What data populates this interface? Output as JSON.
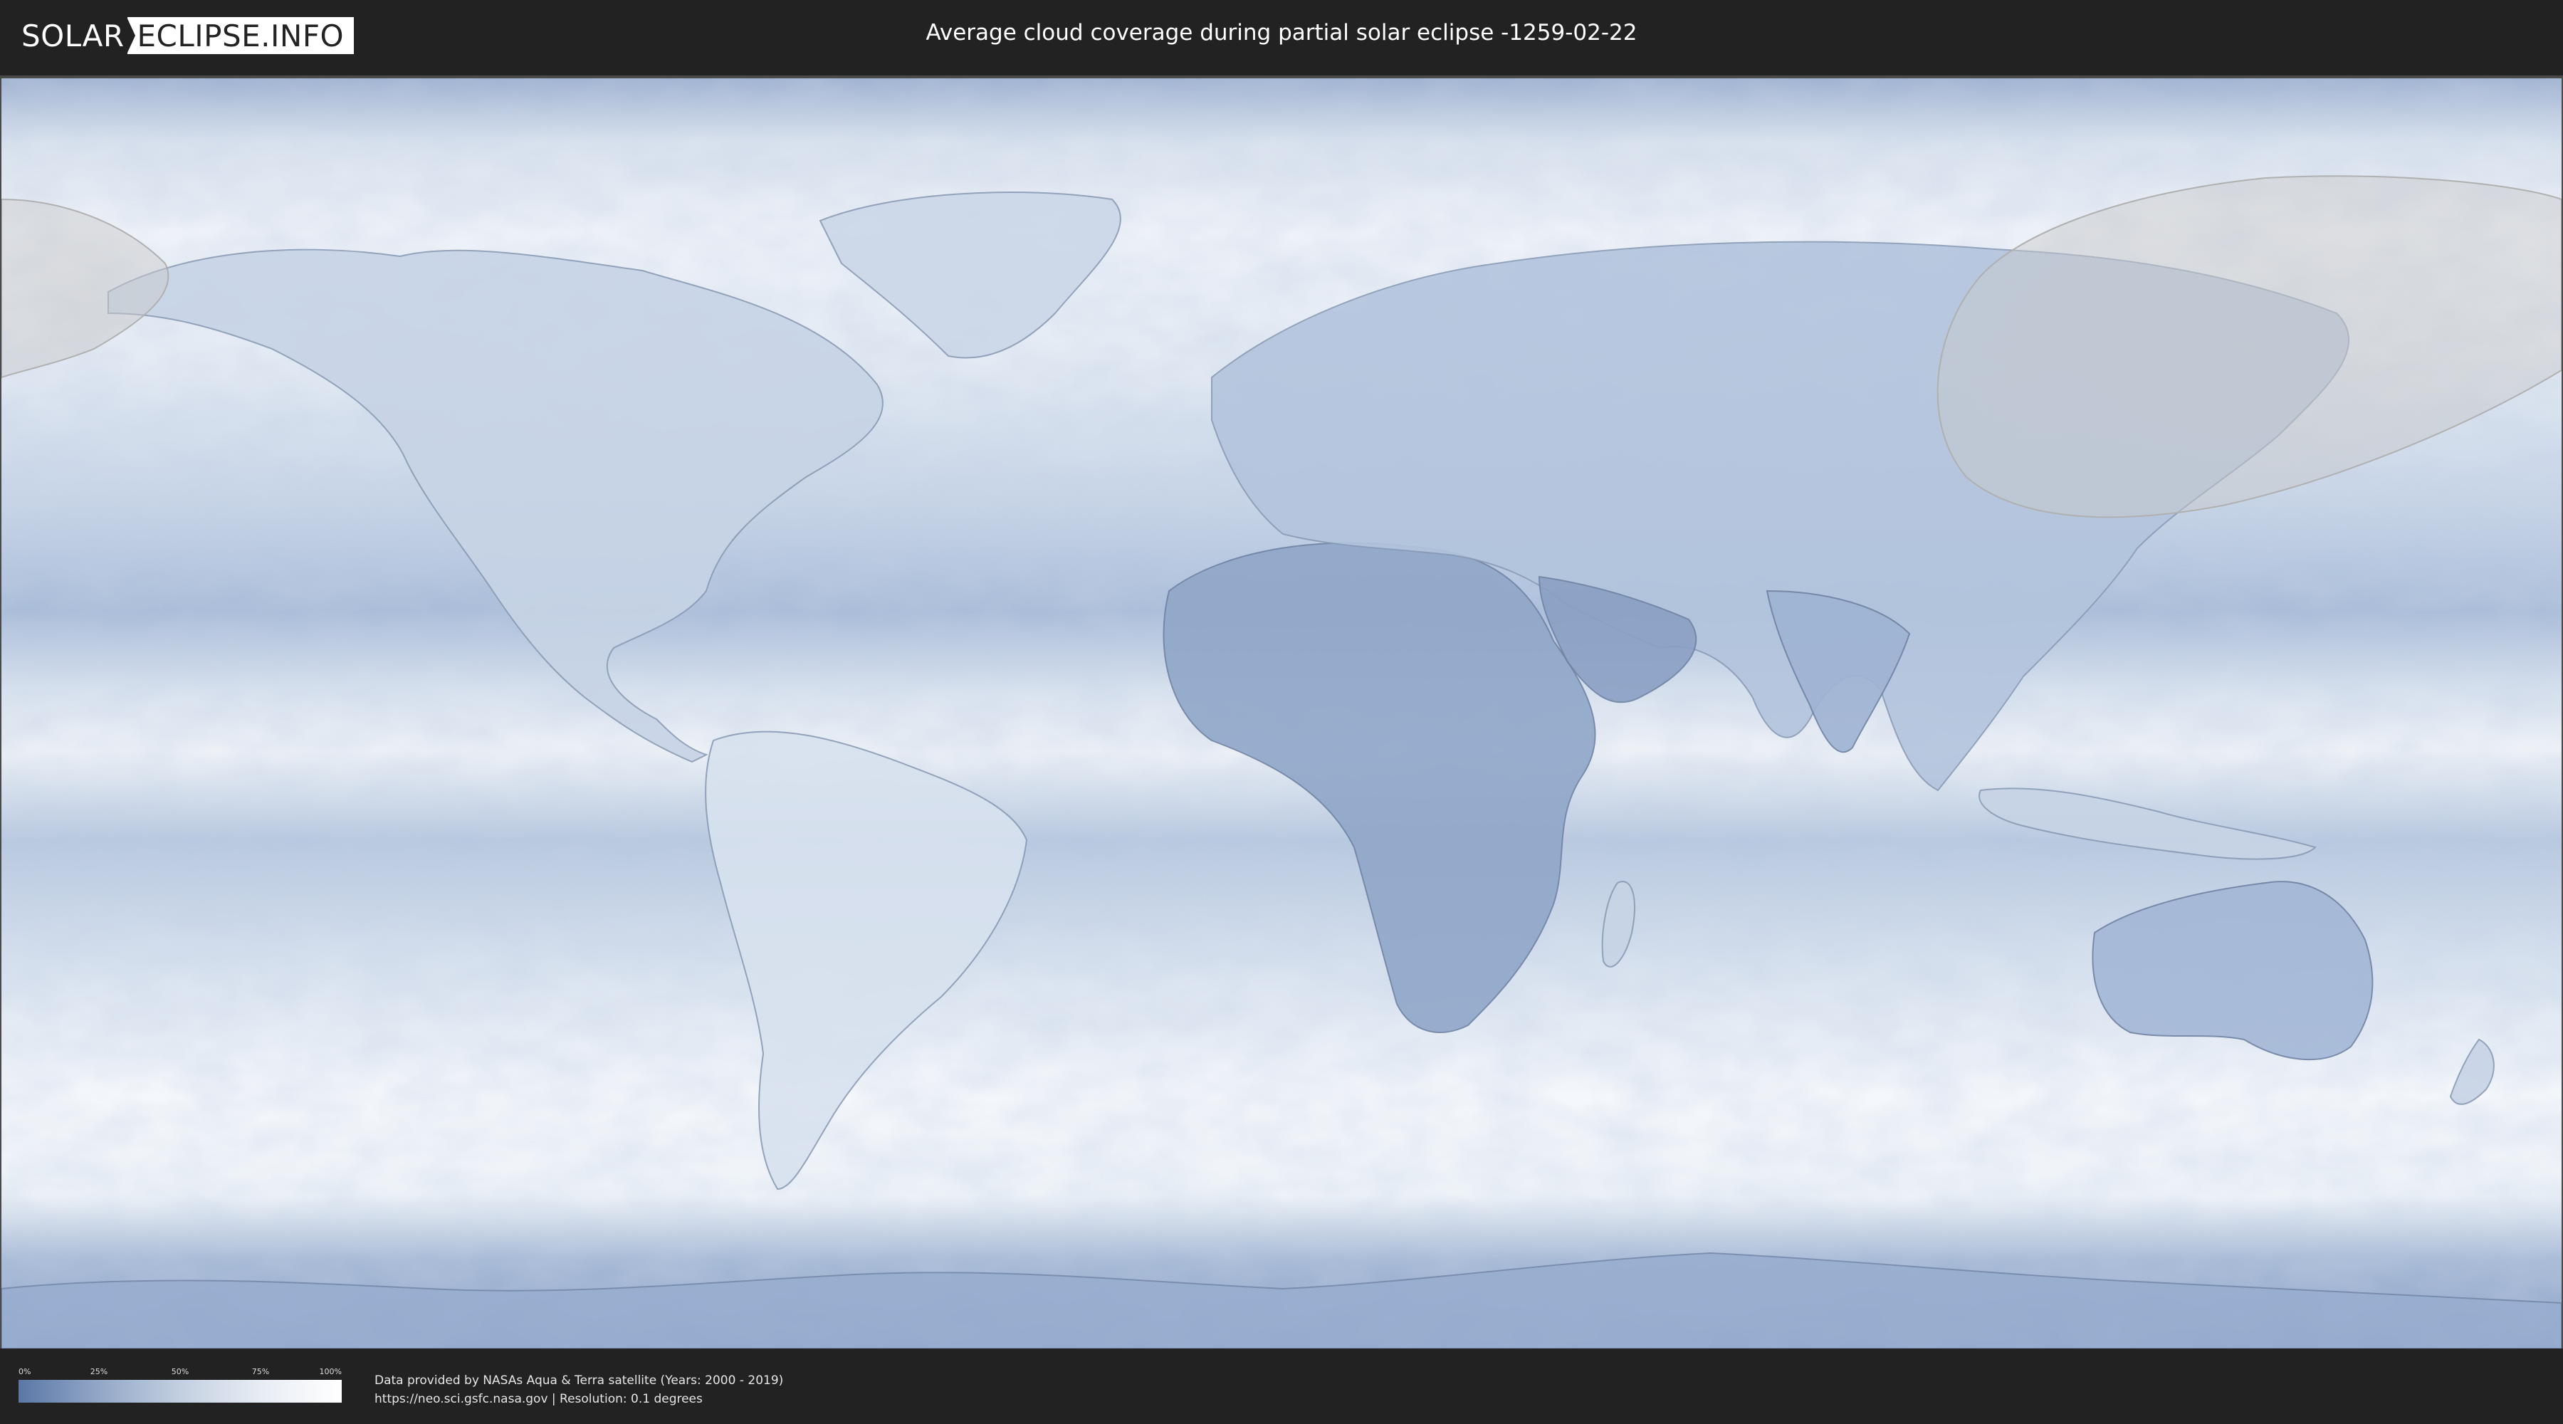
{
  "header": {
    "logo_left": "SOLAR",
    "logo_right": "ECLIPSE.INFO",
    "title": "Average cloud coverage during partial solar eclipse -1259-02-22"
  },
  "legend": {
    "ticks": [
      "0%",
      "25%",
      "50%",
      "75%",
      "100%"
    ],
    "tick_values": [
      0,
      25,
      50,
      75,
      100
    ],
    "color_low": "#5b77a6",
    "color_high": "#ffffff"
  },
  "credits": {
    "line1": "Data provided by NASAs Aqua & Terra satellite (Years: 2000 - 2019)",
    "line2": "https://neo.sci.gsfc.nasa.gov | Resolution: 0.1 degrees"
  },
  "colors": {
    "background": "#222222",
    "ocean": "#dfe7f1",
    "cloud_dense": "#f4f7fb",
    "cloud_sparse": "#7f98c0",
    "eclipse_shade": "#bdbdbd"
  }
}
